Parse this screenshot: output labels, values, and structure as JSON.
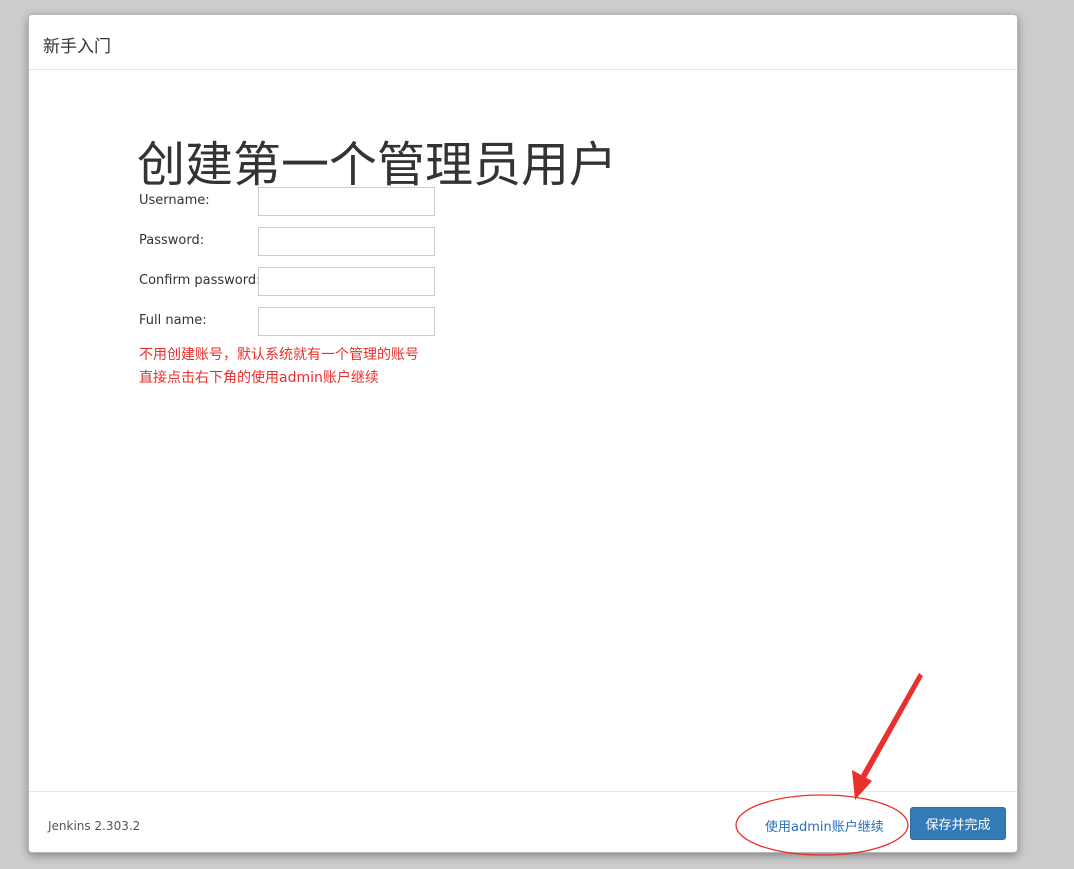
{
  "header": {
    "title": "新手入门"
  },
  "main": {
    "heading": "创建第一个管理员用户",
    "fields": [
      {
        "label": "Username:",
        "value": ""
      },
      {
        "label": "Password:",
        "value": ""
      },
      {
        "label": "Confirm password:",
        "value": ""
      },
      {
        "label": "Full name:",
        "value": ""
      }
    ],
    "annotation": {
      "line1": "不用创建账号，默认系统就有一个管理的账号",
      "line2": "直接点击右下角的使用admin账户继续",
      "color": "#e8302c"
    }
  },
  "footer": {
    "version": "Jenkins 2.303.2",
    "continue_link": "使用admin账户继续",
    "save_button": "保存并完成"
  },
  "colors": {
    "primary_button": "#337ab7",
    "link": "#2a6ebb",
    "annotation": "#e8302c"
  }
}
